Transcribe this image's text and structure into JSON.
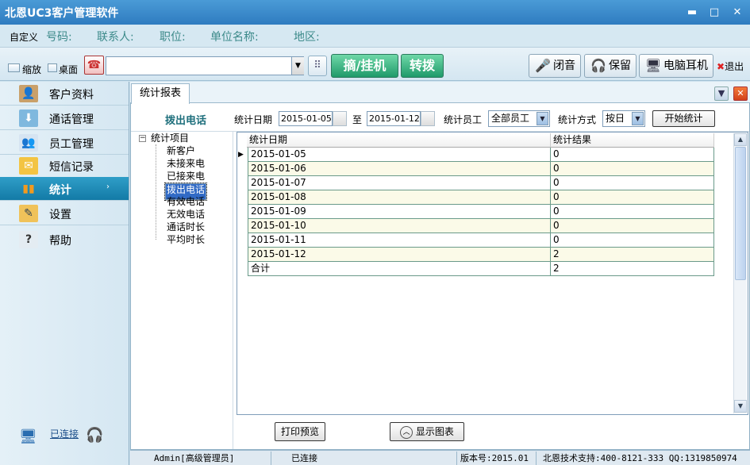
{
  "window": {
    "title": "北恩UC3客户管理软件",
    "minimize": "▬",
    "maximize": "□",
    "close": "✕"
  },
  "infobar": {
    "custom_label": "自定义",
    "phone_label": "号码:",
    "contact_label": "联系人:",
    "position_label": "职位:",
    "company_label": "单位名称:",
    "region_label": "地区:"
  },
  "toolbar": {
    "shrink_label": "缩放",
    "desktop_label": "桌面",
    "dial_value": "",
    "hook_label": "摘/挂机",
    "transfer_label": "转拨",
    "mute_label": "闭音",
    "hold_label": "保留",
    "headset_label": "电脑耳机",
    "exit_label": "退出"
  },
  "sidebar": {
    "items": [
      {
        "label": "客户资料",
        "icon": "customer-icon"
      },
      {
        "label": "通话管理",
        "icon": "call-icon"
      },
      {
        "label": "员工管理",
        "icon": "staff-icon"
      },
      {
        "label": "短信记录",
        "icon": "sms-icon"
      },
      {
        "label": "统计",
        "icon": "stats-icon"
      },
      {
        "label": "设置",
        "icon": "settings-icon"
      },
      {
        "label": "帮助",
        "icon": "help-icon"
      }
    ],
    "connection_status": "已连接"
  },
  "tab": {
    "label": "统计报表"
  },
  "filters": {
    "section_title": "拨出电话",
    "date_label": "统计日期",
    "date_from": "2015-01-05",
    "to_label": "至",
    "date_to": "2015-01-12",
    "staff_label": "统计员工",
    "staff_value": "全部员工",
    "mode_label": "统计方式",
    "mode_value": "按日",
    "start_button": "开始统计"
  },
  "tree": {
    "root": "统计项目",
    "items": [
      "新客户",
      "未接来电",
      "已接来电",
      "拨出电话",
      "有效电话",
      "无效电话",
      "通话时长",
      "平均时长"
    ],
    "selected_index": 3
  },
  "grid": {
    "columns": [
      "统计日期",
      "统计结果"
    ],
    "rows": [
      [
        "2015-01-05",
        "0"
      ],
      [
        "2015-01-06",
        "0"
      ],
      [
        "2015-01-07",
        "0"
      ],
      [
        "2015-01-08",
        "0"
      ],
      [
        "2015-01-09",
        "0"
      ],
      [
        "2015-01-10",
        "0"
      ],
      [
        "2015-01-11",
        "0"
      ],
      [
        "2015-01-12",
        "2"
      ],
      [
        "合计",
        "2"
      ]
    ]
  },
  "buttons": {
    "print_preview": "打印预览",
    "show_chart": "显示图表"
  },
  "statusbar": {
    "user": "Admin[高级管理员]",
    "connection": "已连接",
    "version": "版本号:2015.01",
    "support": "北恩技术支持:400-8121-333 QQ:1319850974"
  }
}
